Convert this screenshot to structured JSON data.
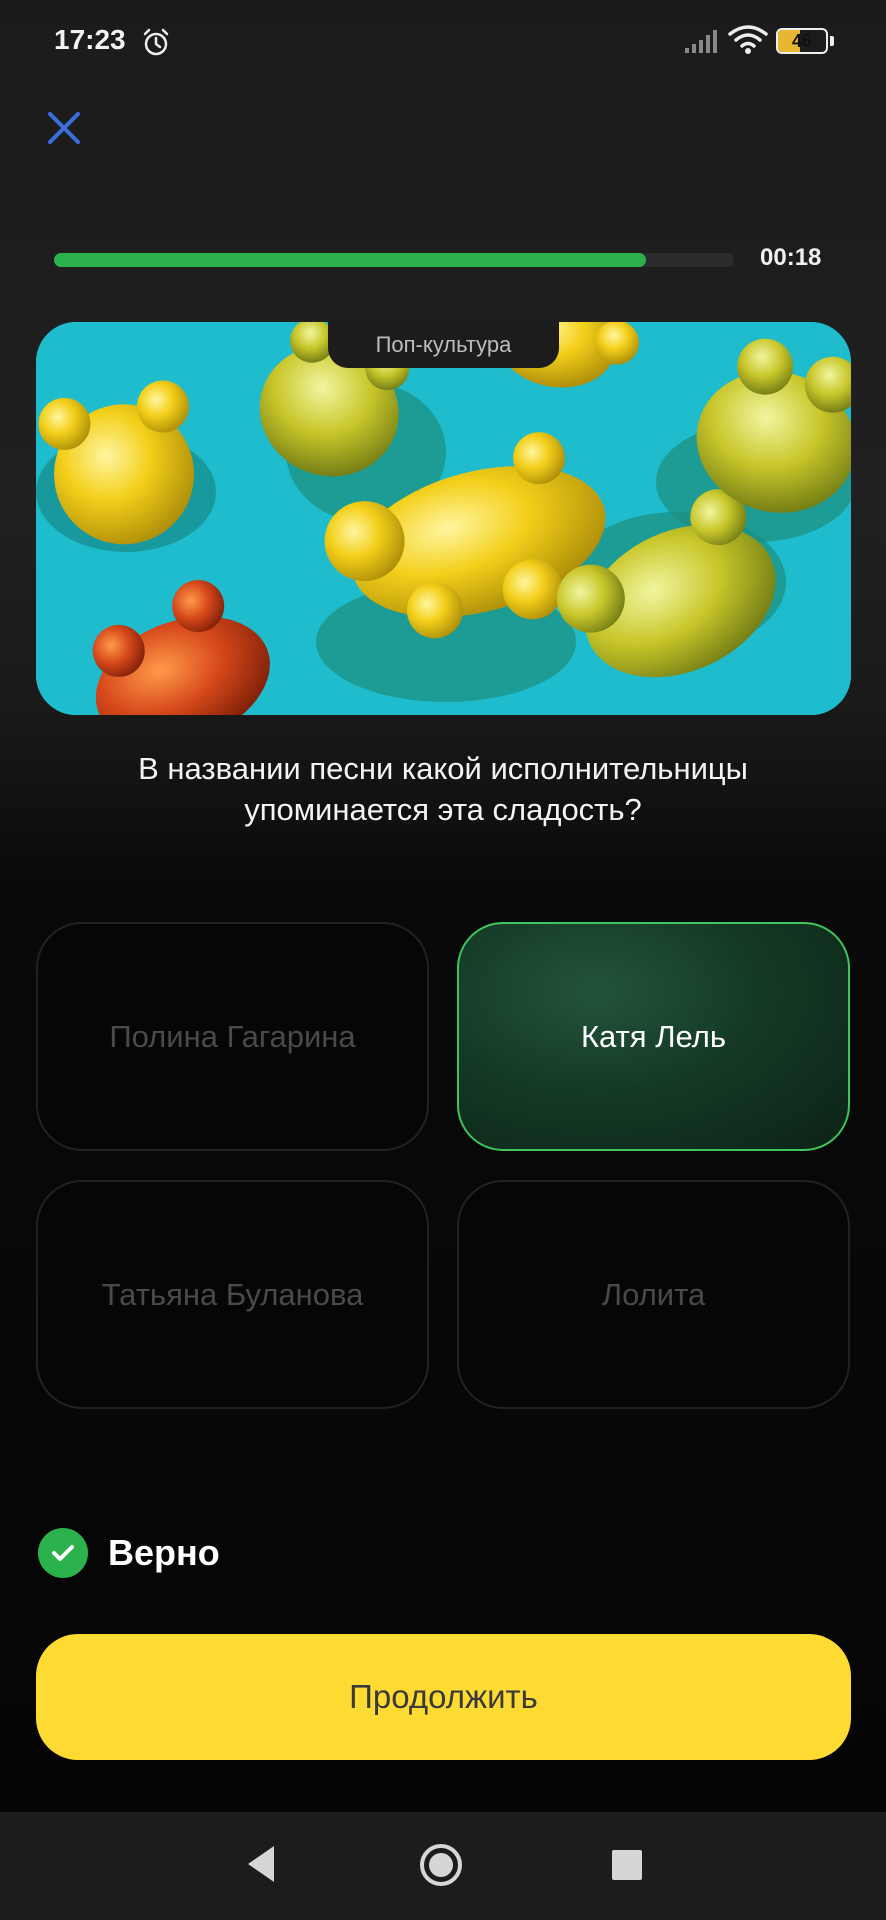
{
  "status_bar": {
    "time": "17:23",
    "battery_level": "46",
    "battery_fraction": 0.46,
    "icons": [
      "alarm-icon",
      "signal-icon",
      "wifi-icon",
      "battery-icon"
    ]
  },
  "header": {
    "close_icon": "close-icon",
    "close_color": "#3a6fe0"
  },
  "progress": {
    "fraction": 0.87,
    "timer": "00:18",
    "color": "#2bb24c"
  },
  "quiz": {
    "category": "Поп-культура",
    "image_description_icon": "gummy-bears-image",
    "question": "В названии песни какой исполнительницы упоминается эта сладость?",
    "answers": [
      {
        "label": "Полина Гагарина",
        "state": "inactive"
      },
      {
        "label": "Катя Лель",
        "state": "correct"
      },
      {
        "label": "Татьяна Буланова",
        "state": "inactive"
      },
      {
        "label": "Лолита",
        "state": "inactive"
      }
    ]
  },
  "result": {
    "icon": "check-circle-icon",
    "text": "Верно",
    "color": "#2bb24c"
  },
  "footer": {
    "continue_label": "Продолжить",
    "continue_color": "#fddb33"
  },
  "nav_bar": {
    "icons": [
      "nav-back-icon",
      "nav-home-icon",
      "nav-recent-icon"
    ]
  }
}
